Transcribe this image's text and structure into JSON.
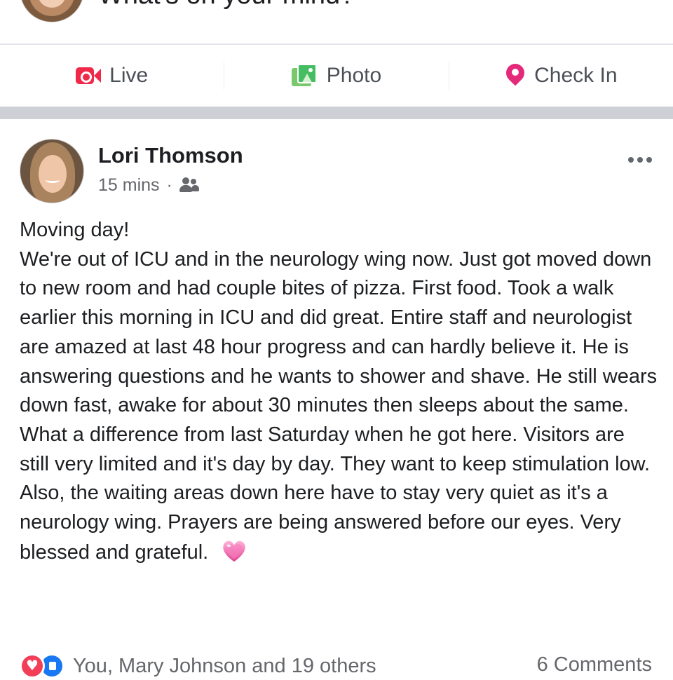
{
  "composer": {
    "prompt": "What's on your mind?"
  },
  "actions": {
    "live_label": "Live",
    "photo_label": "Photo",
    "checkin_label": "Check In"
  },
  "post": {
    "author": "Lori Thomson",
    "timestamp": "15 mins",
    "separator": "·",
    "audience_icon": "friends-icon",
    "body": "Moving day!\nWe're out of ICU and in the neurology wing now.  Just got moved down to new room and had couple bites of pizza. First food. Took a walk earlier this morning in ICU and did great.  Entire staff and neurologist are amazed at last 48 hour progress and can hardly believe it.  He is answering questions and he wants to shower and shave. He still wears down fast, awake for about 30 minutes then sleeps about the same.  What a difference from last Saturday when he got here. Visitors are still very limited and it's day by day. They want to keep stimulation low. Also, the waiting areas down here have to stay very quiet as it's a neurology wing. Prayers are being answered before our eyes. Very blessed and grateful.",
    "emoji": "sparkling-heart-icon"
  },
  "footer": {
    "reaction_names": "You, Mary Johnson and 19 others",
    "comments": "6 Comments"
  },
  "colors": {
    "live_red": "#f02849",
    "photo_green": "#45bd62",
    "checkin_pink": "#e4287a",
    "separator_gray": "#cdd0d4",
    "meta_gray": "#65676b"
  }
}
